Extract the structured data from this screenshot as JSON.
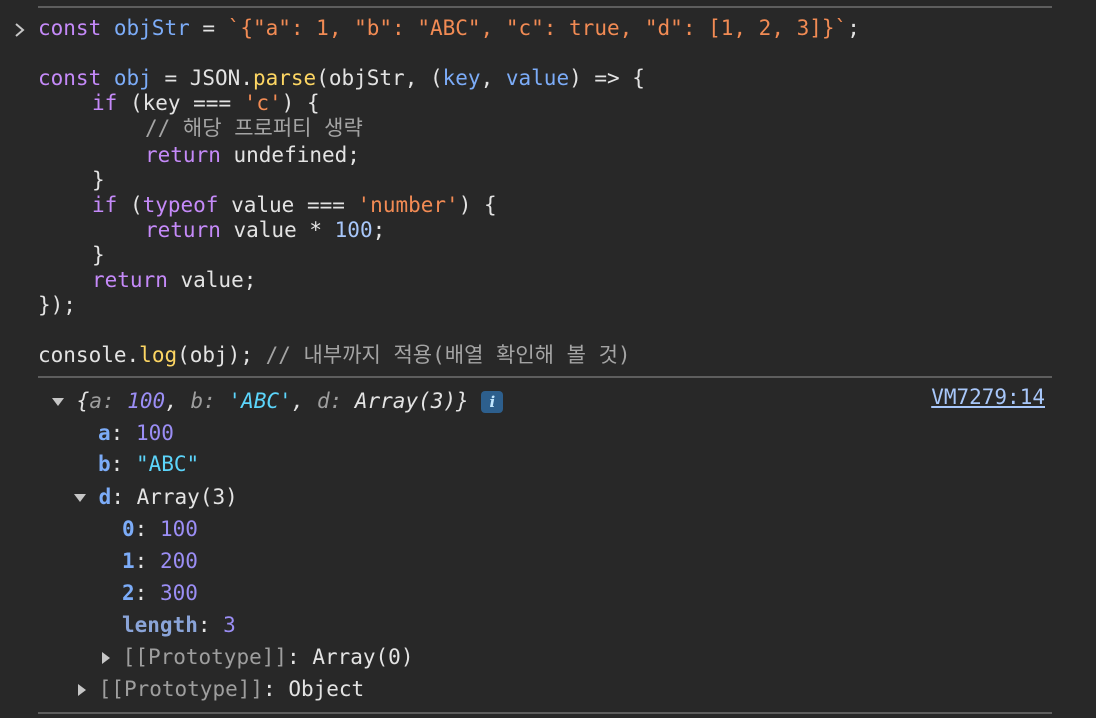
{
  "console": {
    "input": {
      "line1": {
        "kw": "const",
        "name": "objStr",
        "op": " = ",
        "tpl": "`{\"a\": 1, \"b\": \"ABC\", \"c\": true, \"d\": [1, 2, 3]}`",
        "end": ";"
      },
      "line3": {
        "kw": "const",
        "name": "obj",
        "op": " = ",
        "obj": "JSON",
        "dot": ".",
        "fn": "parse",
        "open": "(objStr, (",
        "p1": "key",
        "comma": ", ",
        "p2": "value",
        "arrow": ") => {"
      },
      "line4": {
        "kw": "if",
        "rest1": " (key === ",
        "str": "'c'",
        "rest2": ") {"
      },
      "line5": {
        "comment": "// 해당 프로퍼티 생략"
      },
      "line6": {
        "kw": "return",
        "rest": " undefined;"
      },
      "line7": {
        "text": "}"
      },
      "line8": {
        "kw": "if",
        "rest1": " (",
        "kw2": "typeof",
        "rest2": " value === ",
        "str": "'number'",
        "rest3": ") {"
      },
      "line9": {
        "kw": "return",
        "rest": " value * ",
        "num": "100",
        "end": ";"
      },
      "line10": {
        "text": "}"
      },
      "line11": {
        "kw": "return",
        "rest": " value;"
      },
      "line12": {
        "text": "});"
      },
      "line14": {
        "obj": "console",
        "dot": ".",
        "fn": "log",
        "rest": "(obj); ",
        "comment": "// 내부까지 적용(배열 확인해 볼 것)"
      }
    },
    "output": {
      "source_link": "VM7279:14",
      "preview": {
        "open": "{",
        "k1": "a: ",
        "v1": "100",
        "sep1": ", ",
        "k2": "b: ",
        "v2": "'ABC'",
        "sep2": ", ",
        "k3": "d: ",
        "v3": "Array(3)",
        "close": "}",
        "info": "i"
      },
      "props": {
        "a_key": "a",
        "a_val": "100",
        "b_key": "b",
        "b_val": "\"ABC\"",
        "d_key": "d",
        "d_val": "Array(3)",
        "d_items": [
          {
            "key": "0",
            "val": "100"
          },
          {
            "key": "1",
            "val": "200"
          },
          {
            "key": "2",
            "val": "300"
          }
        ],
        "length_key": "length",
        "length_val": "3",
        "inner_proto_key": "[[Prototype]]",
        "inner_proto_val": "Array(0)",
        "outer_proto_key": "[[Prototype]]",
        "outer_proto_val": "Object"
      },
      "colon": ": "
    }
  }
}
